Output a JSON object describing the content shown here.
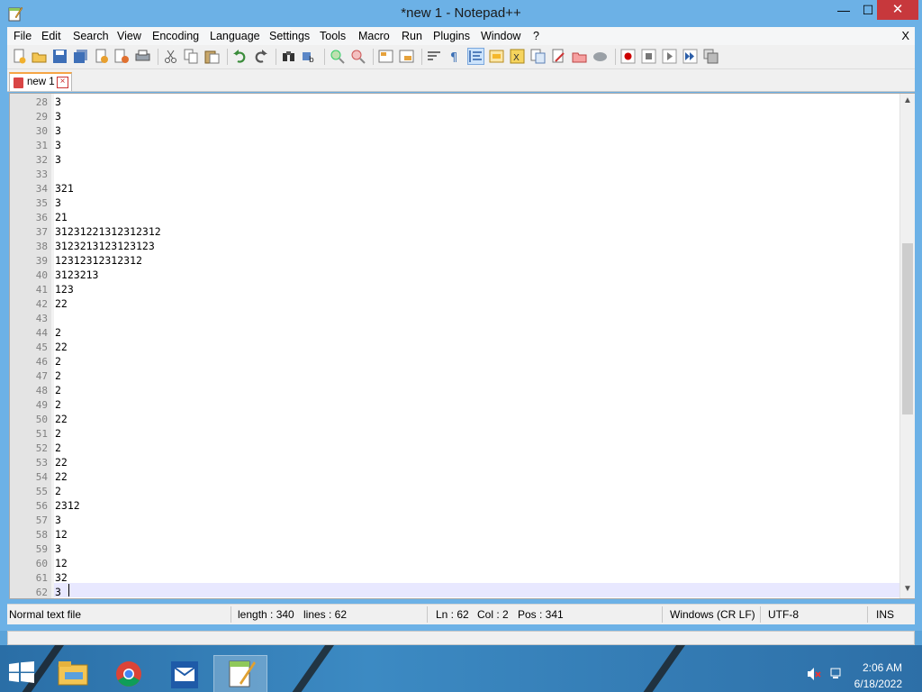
{
  "window": {
    "title": "*new 1 - Notepad++",
    "close_glyph": "✕",
    "min_glyph": "—",
    "max_glyph": "☐"
  },
  "menu": [
    "File",
    "Edit",
    "Search",
    "View",
    "Encoding",
    "Language",
    "Settings",
    "Tools",
    "Macro",
    "Run",
    "Plugins",
    "Window",
    "?"
  ],
  "menu_close": "X",
  "toolbar_icons": [
    "new-file-icon",
    "open-file-icon",
    "save-icon",
    "save-all-icon",
    "close-icon",
    "close-all-icon",
    "print-icon",
    "cut-icon",
    "copy-icon",
    "paste-icon",
    "undo-icon",
    "redo-icon",
    "find-icon",
    "replace-icon",
    "zoom-in-icon",
    "zoom-out-icon",
    "sync-vertical-icon",
    "sync-horizontal-icon",
    "word-wrap-icon",
    "show-all-chars-icon",
    "indent-guide-icon",
    "user-define-lang-icon",
    "doc-map-icon",
    "function-list-icon",
    "folder-workspace-icon",
    "monitoring-icon",
    "record-macro-icon",
    "stop-macro-icon",
    "play-macro-icon",
    "run-macro-multiple-icon",
    "save-macro-icon"
  ],
  "tab": {
    "label": "new 1"
  },
  "editor": {
    "lines": [
      {
        "n": "28",
        "t": "3"
      },
      {
        "n": "29",
        "t": "3"
      },
      {
        "n": "30",
        "t": "3"
      },
      {
        "n": "31",
        "t": "3"
      },
      {
        "n": "32",
        "t": "3"
      },
      {
        "n": "33",
        "t": ""
      },
      {
        "n": "34",
        "t": "321"
      },
      {
        "n": "35",
        "t": "3"
      },
      {
        "n": "36",
        "t": "21"
      },
      {
        "n": "37",
        "t": "31231221312312312"
      },
      {
        "n": "38",
        "t": "3123213123123123"
      },
      {
        "n": "39",
        "t": "12312312312312"
      },
      {
        "n": "40",
        "t": "3123213"
      },
      {
        "n": "41",
        "t": "123"
      },
      {
        "n": "42",
        "t": "22"
      },
      {
        "n": "43",
        "t": ""
      },
      {
        "n": "44",
        "t": "2"
      },
      {
        "n": "45",
        "t": "22"
      },
      {
        "n": "46",
        "t": "2"
      },
      {
        "n": "47",
        "t": "2"
      },
      {
        "n": "48",
        "t": "2"
      },
      {
        "n": "49",
        "t": "2"
      },
      {
        "n": "50",
        "t": "22"
      },
      {
        "n": "51",
        "t": "2"
      },
      {
        "n": "52",
        "t": "2"
      },
      {
        "n": "53",
        "t": "22"
      },
      {
        "n": "54",
        "t": "22"
      },
      {
        "n": "55",
        "t": "2"
      },
      {
        "n": "56",
        "t": "2312"
      },
      {
        "n": "57",
        "t": "3"
      },
      {
        "n": "58",
        "t": "12"
      },
      {
        "n": "59",
        "t": "3"
      },
      {
        "n": "60",
        "t": "12"
      },
      {
        "n": "61",
        "t": "32"
      },
      {
        "n": "62",
        "t": "3"
      }
    ]
  },
  "status": {
    "lang": "Normal text file",
    "length": "length : 340",
    "lines": "lines : 62",
    "ln": "Ln : 62",
    "col": "Col : 2",
    "pos": "Pos : 341",
    "eol": "Windows (CR LF)",
    "encoding": "UTF-8",
    "mode": "INS"
  },
  "taskbar": {
    "time": "2:06 AM",
    "date": "6/18/2022",
    "apps": [
      "file-explorer-icon",
      "chrome-icon",
      "mail-icon",
      "notepadpp-icon"
    ]
  }
}
